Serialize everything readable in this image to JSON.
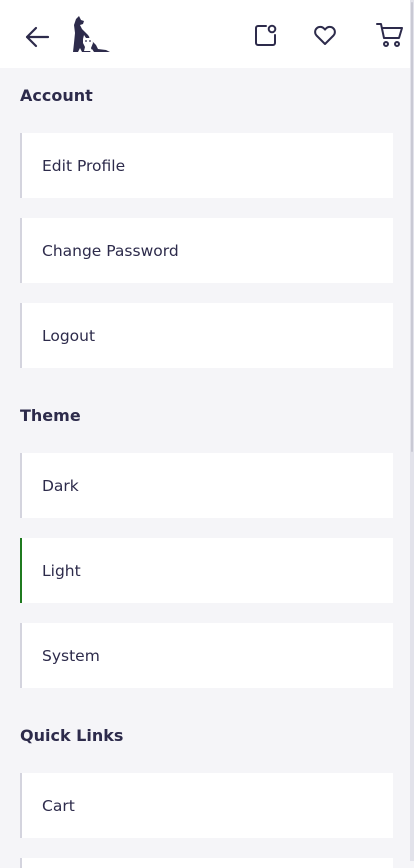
{
  "header": {
    "back_icon": "arrow-left-icon",
    "logo": "dog-and-cat-logo",
    "actions": [
      "share-icon",
      "heart-icon",
      "cart-icon"
    ]
  },
  "sections": {
    "account": {
      "title": "Account",
      "items": [
        {
          "label": "Edit Profile"
        },
        {
          "label": "Change Password"
        },
        {
          "label": "Logout"
        }
      ]
    },
    "theme": {
      "title": "Theme",
      "items": [
        {
          "label": "Dark",
          "selected": false
        },
        {
          "label": "Light",
          "selected": true
        },
        {
          "label": "System",
          "selected": false
        }
      ],
      "selected_color": "#1f7a1f"
    },
    "quick_links": {
      "title": "Quick Links",
      "items": [
        {
          "label": "Cart"
        }
      ]
    }
  },
  "colors": {
    "text": "#2d2b4b",
    "background": "#f5f5f8",
    "card": "#ffffff",
    "accent_active": "#1f7a1f"
  }
}
